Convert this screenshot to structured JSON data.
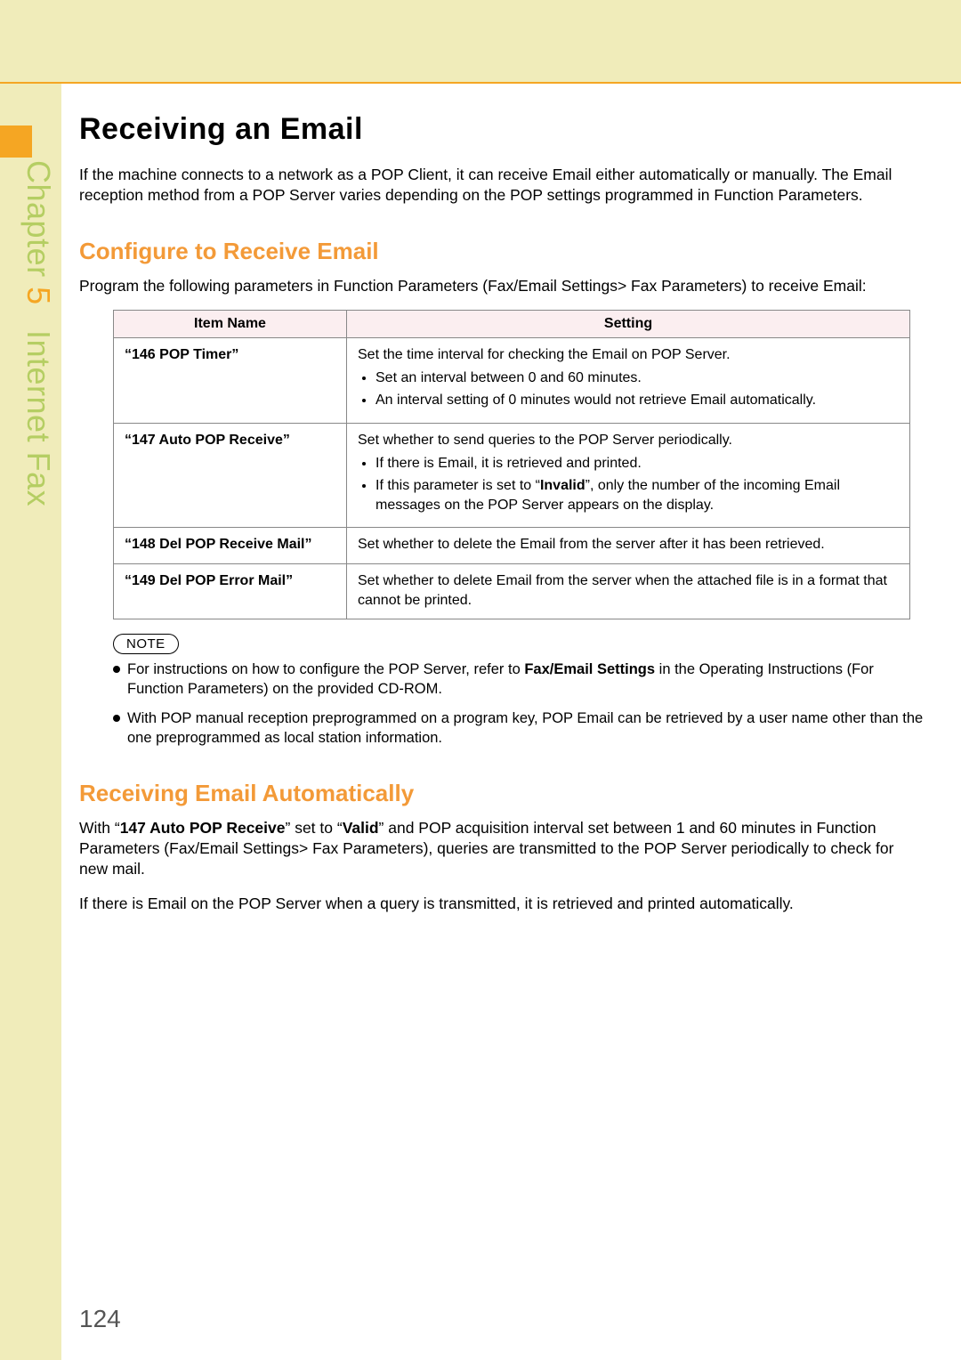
{
  "chapter": {
    "word": "Chapter",
    "number": "5",
    "title": "Internet Fax"
  },
  "h1": "Receiving an Email",
  "intro": "If the machine connects to a network as a POP Client, it can receive Email either automatically or manually. The Email reception method from a POP Server varies depending on the POP settings programmed in Function Parameters.",
  "h2a": "Configure to Receive Email",
  "config_intro": "Program the following parameters in Function Parameters (Fax/Email Settings> Fax Parameters) to receive Email:",
  "table": {
    "head_item": "Item Name",
    "head_setting": "Setting",
    "rows": [
      {
        "item": "“146 POP Timer”",
        "lead": "Set the time interval for checking the Email on POP Server.",
        "bullets": [
          "Set an interval between 0 and 60 minutes.",
          "An interval setting of 0 minutes would not retrieve Email automatically."
        ]
      },
      {
        "item": "“147 Auto POP Receive”",
        "lead": "Set whether to send queries to the POP Server periodically.",
        "bullets_html": [
          "If there is Email, it is retrieved and printed.",
          "If this parameter is set to “<b>Invalid</b>”, only the number of the incoming Email messages on the POP Server appears on the display."
        ]
      },
      {
        "item": "“148 Del POP Receive Mail”",
        "lead": "Set whether to delete the Email from the server after it has been retrieved."
      },
      {
        "item": "“149 Del POP Error Mail”",
        "lead": "Set whether to delete Email from the server when the attached file is in a format that cannot be printed."
      }
    ]
  },
  "note_label": "NOTE",
  "notes": [
    {
      "pre": "For instructions on how to configure the POP Server, refer to ",
      "bold": "Fax/Email Settings",
      "post": " in the Operating Instructions (For Function Parameters) on the provided CD-ROM."
    },
    {
      "pre": "With POP manual reception preprogrammed on a program key, POP Email can be retrieved by a user name other than the one preprogrammed as local station information.",
      "bold": "",
      "post": ""
    }
  ],
  "h2b": "Receiving Email Automatically",
  "auto_p1_parts": {
    "a": "With “",
    "b": "147 Auto POP Receive",
    "c": "” set to “",
    "d": "Valid",
    "e": "” and POP acquisition interval set between 1 and 60 minutes in Function Parameters (Fax/Email Settings> Fax Parameters), queries are transmitted to the POP Server periodically to check for new mail."
  },
  "auto_p2": "If there is Email on the POP Server when a query is transmitted, it is retrieved and printed automatically.",
  "page_number": "124"
}
